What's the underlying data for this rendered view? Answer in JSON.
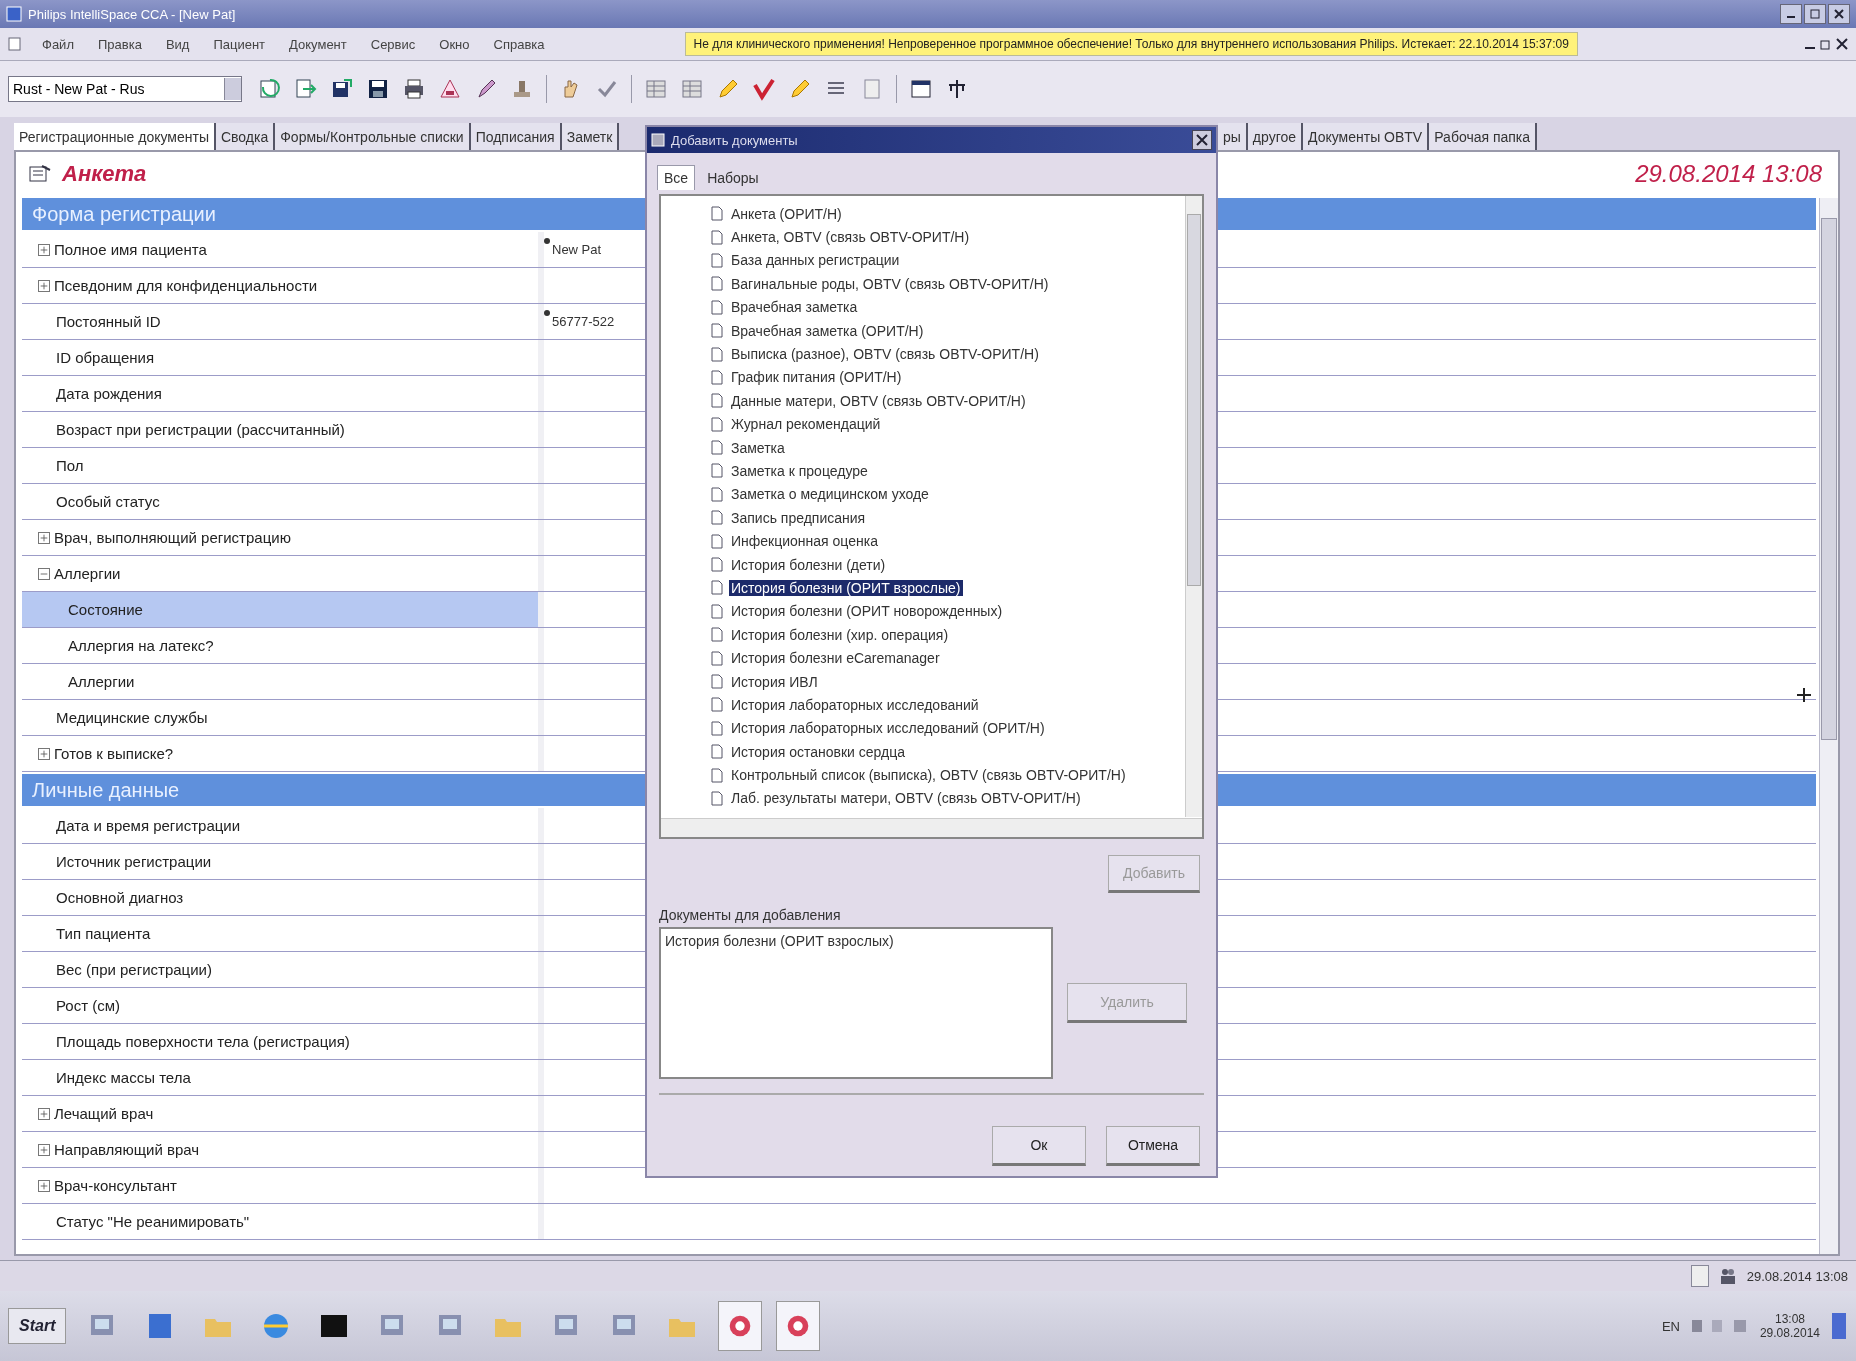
{
  "window": {
    "title": "Philips IntelliSpace CCA - [New Pat]"
  },
  "menu": [
    "Файл",
    "Правка",
    "Вид",
    "Пациент",
    "Документ",
    "Сервис",
    "Окно",
    "Справка"
  ],
  "banner": "Не для клинического применения! Непроверенное программное обеспечение! Только для внутреннего использования Philips. Истекает: 22.10.2014 15:37:09",
  "toolbar": {
    "patient_select": "Rust - New Pat - Rus"
  },
  "tabs": {
    "left": [
      {
        "label": "Регистрационные документы",
        "selected": true
      },
      {
        "label": "Сводка",
        "selected": false
      },
      {
        "label": "Формы/Контрольные списки",
        "selected": false
      },
      {
        "label": "Подписания",
        "selected": false
      },
      {
        "label": "Заметк",
        "selected": false
      }
    ],
    "right": [
      {
        "label": "ры",
        "selected": false
      },
      {
        "label": "другое",
        "selected": false
      },
      {
        "label": "Документы OBTV",
        "selected": false
      },
      {
        "label": "Рабочая папка",
        "selected": false
      }
    ]
  },
  "form": {
    "title": "Анкета",
    "datetime": "29.08.2014  13:08",
    "sections": [
      {
        "title": "Форма регистрации",
        "rows": [
          {
            "kind": "expandable",
            "label": "Полное имя пациента",
            "expanded": false,
            "required": true,
            "value": "New Pat",
            "selected": false
          },
          {
            "kind": "expandable",
            "label": "Псевдоним для конфиденциальности",
            "expanded": false,
            "required": false,
            "selected": false
          },
          {
            "kind": "field",
            "label": "Постоянный ID",
            "required": true,
            "value": "56777-522",
            "selected": false
          },
          {
            "kind": "field",
            "label": "ID обращения",
            "required": false,
            "selected": false
          },
          {
            "kind": "field",
            "label": "Дата рождения",
            "required": false,
            "selected": false
          },
          {
            "kind": "field",
            "label": "Возраст при регистрации (рассчитанный)",
            "required": false,
            "selected": false
          },
          {
            "kind": "field",
            "label": "Пол",
            "required": false,
            "selected": false
          },
          {
            "kind": "field",
            "label": "Особый статус",
            "required": false,
            "selected": false
          },
          {
            "kind": "expandable",
            "label": "Врач, выполняющий регистрацию",
            "expanded": false,
            "required": false,
            "selected": false
          },
          {
            "kind": "expandable",
            "label": "Аллергии",
            "expanded": true,
            "required": false,
            "selected": false,
            "children": [
              {
                "kind": "field",
                "label": "Состояние",
                "required": false,
                "selected": true
              },
              {
                "kind": "field",
                "label": "Аллергия на латекс?",
                "required": false,
                "selected": false
              },
              {
                "kind": "field",
                "label": "Аллергии",
                "required": false,
                "selected": false
              }
            ]
          },
          {
            "kind": "field",
            "label": "Медицинские службы",
            "required": false,
            "selected": false
          },
          {
            "kind": "expandable",
            "label": "Готов к выписке?",
            "expanded": false,
            "required": false,
            "selected": false
          }
        ]
      },
      {
        "title": "Личные данные",
        "rows": [
          {
            "kind": "field",
            "label": "Дата и время регистрации",
            "required": false,
            "selected": false
          },
          {
            "kind": "field",
            "label": "Источник регистрации",
            "required": false,
            "selected": false
          },
          {
            "kind": "field",
            "label": "Основной диагноз",
            "required": false,
            "selected": false
          },
          {
            "kind": "field",
            "label": "Тип пациента",
            "required": false,
            "selected": false
          },
          {
            "kind": "field",
            "label": "Вес (при регистрации)",
            "required": false,
            "selected": false
          },
          {
            "kind": "field",
            "label": "Рост (см)",
            "required": false,
            "selected": false
          },
          {
            "kind": "field",
            "label": "Площадь поверхности тела (регистрация)",
            "required": false,
            "selected": false
          },
          {
            "kind": "field",
            "label": "Индекс массы тела",
            "required": false,
            "selected": false
          },
          {
            "kind": "expandable",
            "label": "Лечащий врач",
            "expanded": false,
            "required": false,
            "selected": false
          },
          {
            "kind": "expandable",
            "label": "Направляющий врач",
            "expanded": false,
            "required": false,
            "selected": false
          },
          {
            "kind": "expandable",
            "label": "Врач-консультант",
            "expanded": false,
            "required": false,
            "selected": false
          },
          {
            "kind": "field",
            "label": "Статус \"Не реанимировать\"",
            "required": false,
            "selected": false
          }
        ]
      }
    ]
  },
  "dialog": {
    "title": "Добавить документы",
    "tabs": [
      {
        "label": "Все",
        "selected": true
      },
      {
        "label": "Наборы",
        "selected": false
      }
    ],
    "documents": [
      {
        "label": "Анкета (ОРИТ/Н)",
        "selected": false
      },
      {
        "label": "Анкета, OBTV (связь OBTV-ОРИТ/Н)",
        "selected": false
      },
      {
        "label": "База данных регистрации",
        "selected": false
      },
      {
        "label": "Вагинальные роды, OBTV (связь OBTV-ОРИТ/Н)",
        "selected": false
      },
      {
        "label": "Врачебная заметка",
        "selected": false
      },
      {
        "label": "Врачебная заметка (ОРИТ/Н)",
        "selected": false
      },
      {
        "label": "Выписка (разное), OBTV (связь OBTV-ОРИТ/Н)",
        "selected": false
      },
      {
        "label": "График питания (ОРИТ/Н)",
        "selected": false
      },
      {
        "label": "Данные матери, OBTV (связь OBTV-ОРИТ/Н)",
        "selected": false
      },
      {
        "label": "Журнал рекомендаций",
        "selected": false
      },
      {
        "label": "Заметка",
        "selected": false
      },
      {
        "label": "Заметка к процедуре",
        "selected": false
      },
      {
        "label": "Заметка о медицинском уходе",
        "selected": false
      },
      {
        "label": "Запись предписания",
        "selected": false
      },
      {
        "label": "Инфекционная оценка",
        "selected": false
      },
      {
        "label": "История болезни (дети)",
        "selected": false
      },
      {
        "label": "История болезни (ОРИТ взрослые)",
        "selected": true
      },
      {
        "label": "История болезни (ОРИТ новорожденных)",
        "selected": false
      },
      {
        "label": "История болезни (хир. операция)",
        "selected": false
      },
      {
        "label": "История болезни eCaremanager",
        "selected": false
      },
      {
        "label": "История ИВЛ",
        "selected": false
      },
      {
        "label": "История лабораторных исследований",
        "selected": false
      },
      {
        "label": "История лабораторных исследований (ОРИТ/Н)",
        "selected": false
      },
      {
        "label": "История остановки сердца",
        "selected": false
      },
      {
        "label": "Контрольный список (выписка), OBTV (связь OBTV-ОРИТ/Н)",
        "selected": false
      },
      {
        "label": "Лаб. результаты матери, OBTV (связь OBTV-ОРИТ/Н)",
        "selected": false
      }
    ],
    "add_button": {
      "label": "Добавить",
      "disabled": true
    },
    "queue": {
      "title": "Документы для добавления",
      "items": [
        "История болезни (ОРИТ взрослых)"
      ]
    },
    "remove_button": {
      "label": "Удалить",
      "disabled": true
    },
    "buttons": [
      "Ок",
      "Отмена"
    ]
  },
  "status_bar": {
    "datetime": "29.08.2014 13:08"
  },
  "taskbar": {
    "start": "Start",
    "language": "EN",
    "time": "13:08",
    "date": "29.08.2014"
  }
}
